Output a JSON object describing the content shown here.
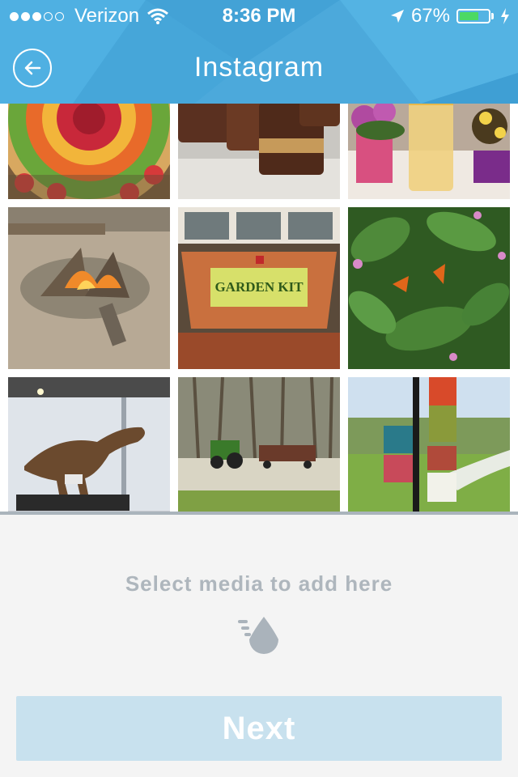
{
  "status_bar": {
    "signal_bars_filled": 3,
    "signal_bars_total": 5,
    "carrier": "Verizon",
    "time": "8:36 PM",
    "battery_percent_label": "67%",
    "battery_level": 0.67,
    "icons": [
      "wifi-icon",
      "location-arrow-icon",
      "battery-icon",
      "charging-bolt-icon"
    ]
  },
  "nav": {
    "title": "Instagram",
    "back_icon": "back-arrow-icon"
  },
  "colors": {
    "header": "#49a9dc",
    "battery": "#4cd964",
    "panel_background": "#f4f4f4",
    "hint_text": "#aeb6bd",
    "next_button_disabled": "#c8e1ee"
  },
  "photos": [
    {
      "name": "photo-fruit-tart"
    },
    {
      "name": "photo-chocolate-bars"
    },
    {
      "name": "photo-flowers-and-drink"
    },
    {
      "name": "photo-campfire"
    },
    {
      "name": "photo-garden-kit-box",
      "label_text": "GARDEN KIT"
    },
    {
      "name": "photo-butterflies-on-plants"
    },
    {
      "name": "photo-dinosaur-exhibit"
    },
    {
      "name": "photo-tractor-hayride"
    },
    {
      "name": "photo-park-signs"
    }
  ],
  "selection_panel": {
    "hint": "Select media to add here",
    "icon": "water-drop-icon",
    "next_label": "Next"
  }
}
